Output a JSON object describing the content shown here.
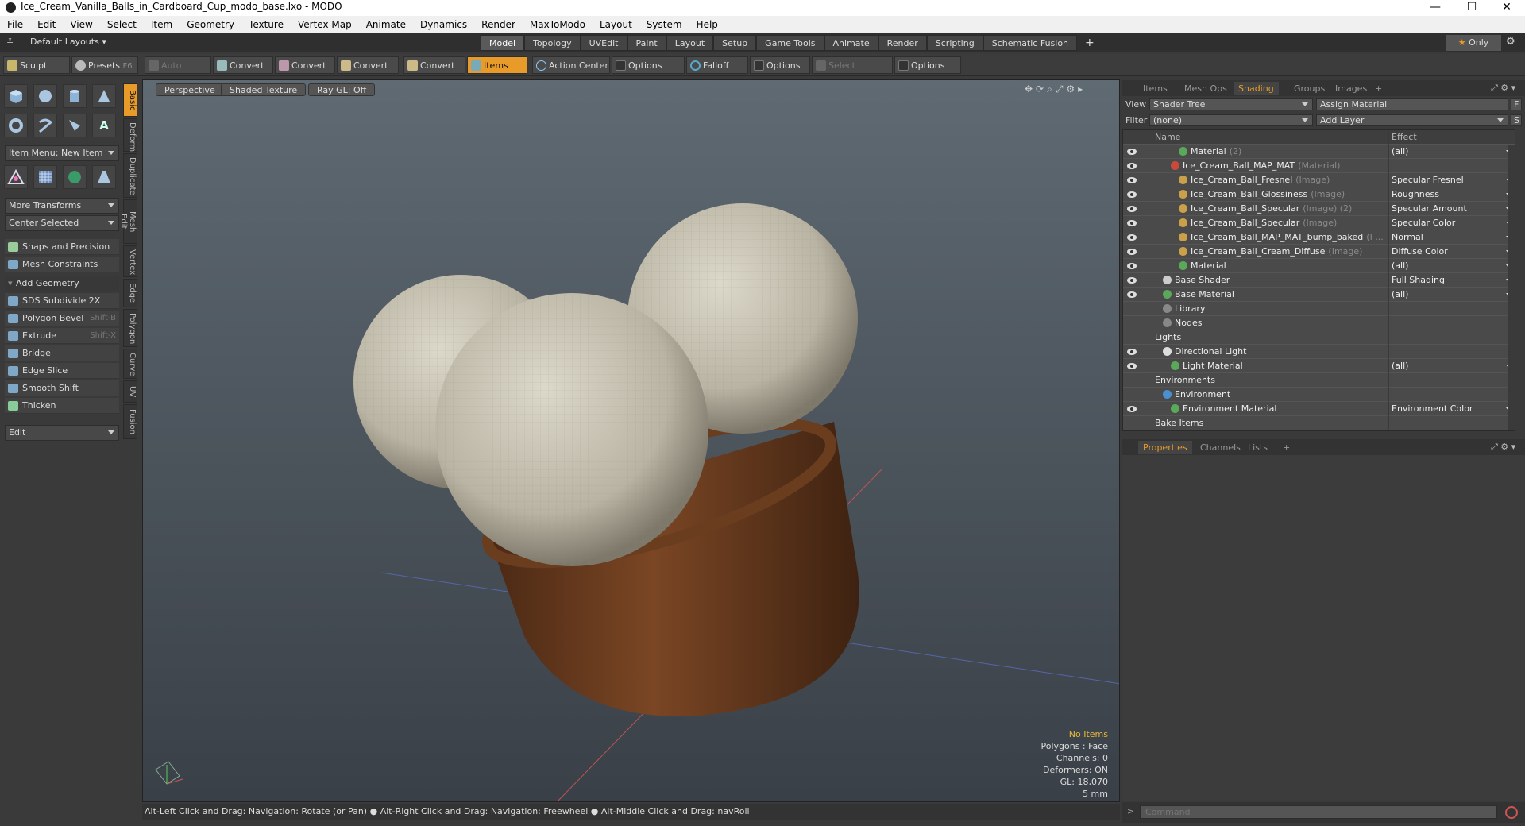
{
  "window": {
    "title": "Ice_Cream_Vanilla_Balls_in_Cardboard_Cup_modo_base.lxo - MODO",
    "minimize": "—",
    "maximize": "☐",
    "close": "✕"
  },
  "menu": [
    "File",
    "Edit",
    "View",
    "Select",
    "Item",
    "Geometry",
    "Texture",
    "Vertex Map",
    "Animate",
    "Dynamics",
    "Render",
    "MaxToModo",
    "Layout",
    "System",
    "Help"
  ],
  "layoutbar": {
    "preset": "Default Layouts",
    "tabs": [
      "Model",
      "Topology",
      "UVEdit",
      "Paint",
      "Layout",
      "Setup",
      "Game Tools",
      "Animate",
      "Render",
      "Scripting",
      "Schematic Fusion"
    ],
    "active_tab": "Model",
    "add": "+",
    "only": "Only",
    "only_star": "★"
  },
  "toolbar": {
    "sculpt": "Sculpt",
    "presets": "Presets",
    "presets_key": "F6",
    "auto_select": "Auto Select",
    "convert1": "Convert",
    "convert2": "Convert",
    "convert3": "Convert",
    "convert4": "Convert",
    "items": "Items",
    "action_center": "Action Center",
    "options1": "Options",
    "falloff": "Falloff",
    "options2": "Options",
    "select_through": "Select Through",
    "options3": "Options"
  },
  "leftpanel": {
    "item_menu": "Item Menu: New Item",
    "more_transforms": "More Transforms",
    "center_selected": "Center Selected",
    "snaps": "Snaps and Precision",
    "mesh_constraints": "Mesh Constraints",
    "add_geometry": "Add Geometry",
    "tools": [
      {
        "label": "SDS Subdivide 2X",
        "key": ""
      },
      {
        "label": "Polygon Bevel",
        "key": "Shift-B"
      },
      {
        "label": "Extrude",
        "key": "Shift-X"
      },
      {
        "label": "Bridge",
        "key": ""
      },
      {
        "label": "Edge Slice",
        "key": ""
      },
      {
        "label": "Smooth Shift",
        "key": ""
      },
      {
        "label": "Thicken",
        "key": ""
      }
    ],
    "edit": "Edit",
    "vtabs": [
      "Basic",
      "Deform",
      "Duplicate",
      "Mesh Edit",
      "Vertex",
      "Edge",
      "Polygon",
      "Curve",
      "UV",
      "Fusion"
    ]
  },
  "viewport": {
    "view": "Perspective",
    "shading": "Shaded Texture",
    "raygl": "Ray GL: Off",
    "stats": {
      "items": "No Items",
      "polygons": "Polygons : Face",
      "channels": "Channels: 0",
      "deformers": "Deformers: ON",
      "gl": "GL: 18,070",
      "scale": "5 mm"
    }
  },
  "statusbar": "Alt-Left Click and Drag: Navigation: Rotate (or Pan) ● Alt-Right Click and Drag: Navigation: Freewheel ● Alt-Middle Click and Drag: navRoll",
  "right": {
    "tabs": [
      "Items",
      "Mesh Ops",
      "Shading",
      "Groups",
      "Images",
      "+"
    ],
    "active_tab": "Shading",
    "view_label": "View",
    "view_value": "Shader Tree",
    "assign": "Assign Material",
    "f_btn": "F",
    "filter_label": "Filter",
    "filter_value": "(none)",
    "add_layer": "Add Layer",
    "s_btn": "S",
    "col_name": "Name",
    "col_effect": "Effect",
    "rows": [
      {
        "name": "Material",
        "sub": "(2)",
        "effect": "(all)",
        "indent": 70,
        "kind": "mat",
        "eye": true
      },
      {
        "name": "Ice_Cream_Ball_MAP_MAT",
        "sub": "(Material)",
        "effect": "",
        "indent": 60,
        "kind": "red",
        "eye": true
      },
      {
        "name": "Ice_Cream_Ball_Fresnel",
        "sub": "(Image)",
        "effect": "Specular Fresnel",
        "indent": 70,
        "kind": "img",
        "eye": true
      },
      {
        "name": "Ice_Cream_Ball_Glossiness",
        "sub": "(Image)",
        "effect": "Roughness",
        "indent": 70,
        "kind": "img",
        "eye": true
      },
      {
        "name": "Ice_Cream_Ball_Specular",
        "sub": "(Image) (2)",
        "effect": "Specular Amount",
        "indent": 70,
        "kind": "img",
        "eye": true
      },
      {
        "name": "Ice_Cream_Ball_Specular",
        "sub": "(Image)",
        "effect": "Specular Color",
        "indent": 70,
        "kind": "img",
        "eye": true
      },
      {
        "name": "Ice_Cream_Ball_MAP_MAT_bump_baked",
        "sub": "(I ...",
        "effect": "Normal",
        "indent": 70,
        "kind": "img",
        "eye": true
      },
      {
        "name": "Ice_Cream_Ball_Cream_Diffuse",
        "sub": "(Image)",
        "effect": "Diffuse Color",
        "indent": 70,
        "kind": "img",
        "eye": true
      },
      {
        "name": "Material",
        "sub": "",
        "effect": "(all)",
        "indent": 70,
        "kind": "mat",
        "eye": true
      },
      {
        "name": "Base Shader",
        "sub": "",
        "effect": "Full Shading",
        "indent": 50,
        "kind": "shader",
        "eye": true
      },
      {
        "name": "Base Material",
        "sub": "",
        "effect": "(all)",
        "indent": 50,
        "kind": "mat",
        "eye": true
      },
      {
        "name": "Library",
        "sub": "",
        "effect": "",
        "indent": 50,
        "kind": "folder",
        "eye": false
      },
      {
        "name": "Nodes",
        "sub": "",
        "effect": "",
        "indent": 50,
        "kind": "folder",
        "eye": false
      },
      {
        "name": "Lights",
        "sub": "",
        "effect": "",
        "indent": 40,
        "kind": "none",
        "eye": false
      },
      {
        "name": "Directional Light",
        "sub": "",
        "effect": "",
        "indent": 50,
        "kind": "light",
        "eye": true
      },
      {
        "name": "Light Material",
        "sub": "",
        "effect": "(all)",
        "indent": 60,
        "kind": "mat",
        "eye": true
      },
      {
        "name": "Environments",
        "sub": "",
        "effect": "",
        "indent": 40,
        "kind": "none",
        "eye": false
      },
      {
        "name": "Environment",
        "sub": "",
        "effect": "",
        "indent": 50,
        "kind": "env",
        "eye": false
      },
      {
        "name": "Environment Material",
        "sub": "",
        "effect": "Environment Color",
        "indent": 60,
        "kind": "mat",
        "eye": true
      },
      {
        "name": "Bake Items",
        "sub": "",
        "effect": "",
        "indent": 40,
        "kind": "none",
        "eye": false
      }
    ],
    "prop_tabs": [
      "Properties",
      "Channels",
      "Lists",
      "+"
    ],
    "prop_active": "Properties",
    "command_placeholder": "Command",
    "cmd_prompt": ">"
  },
  "colors": {
    "accent": "#e99b2a",
    "cup": "#6b3d1f",
    "cream": "#d8d4c6"
  }
}
